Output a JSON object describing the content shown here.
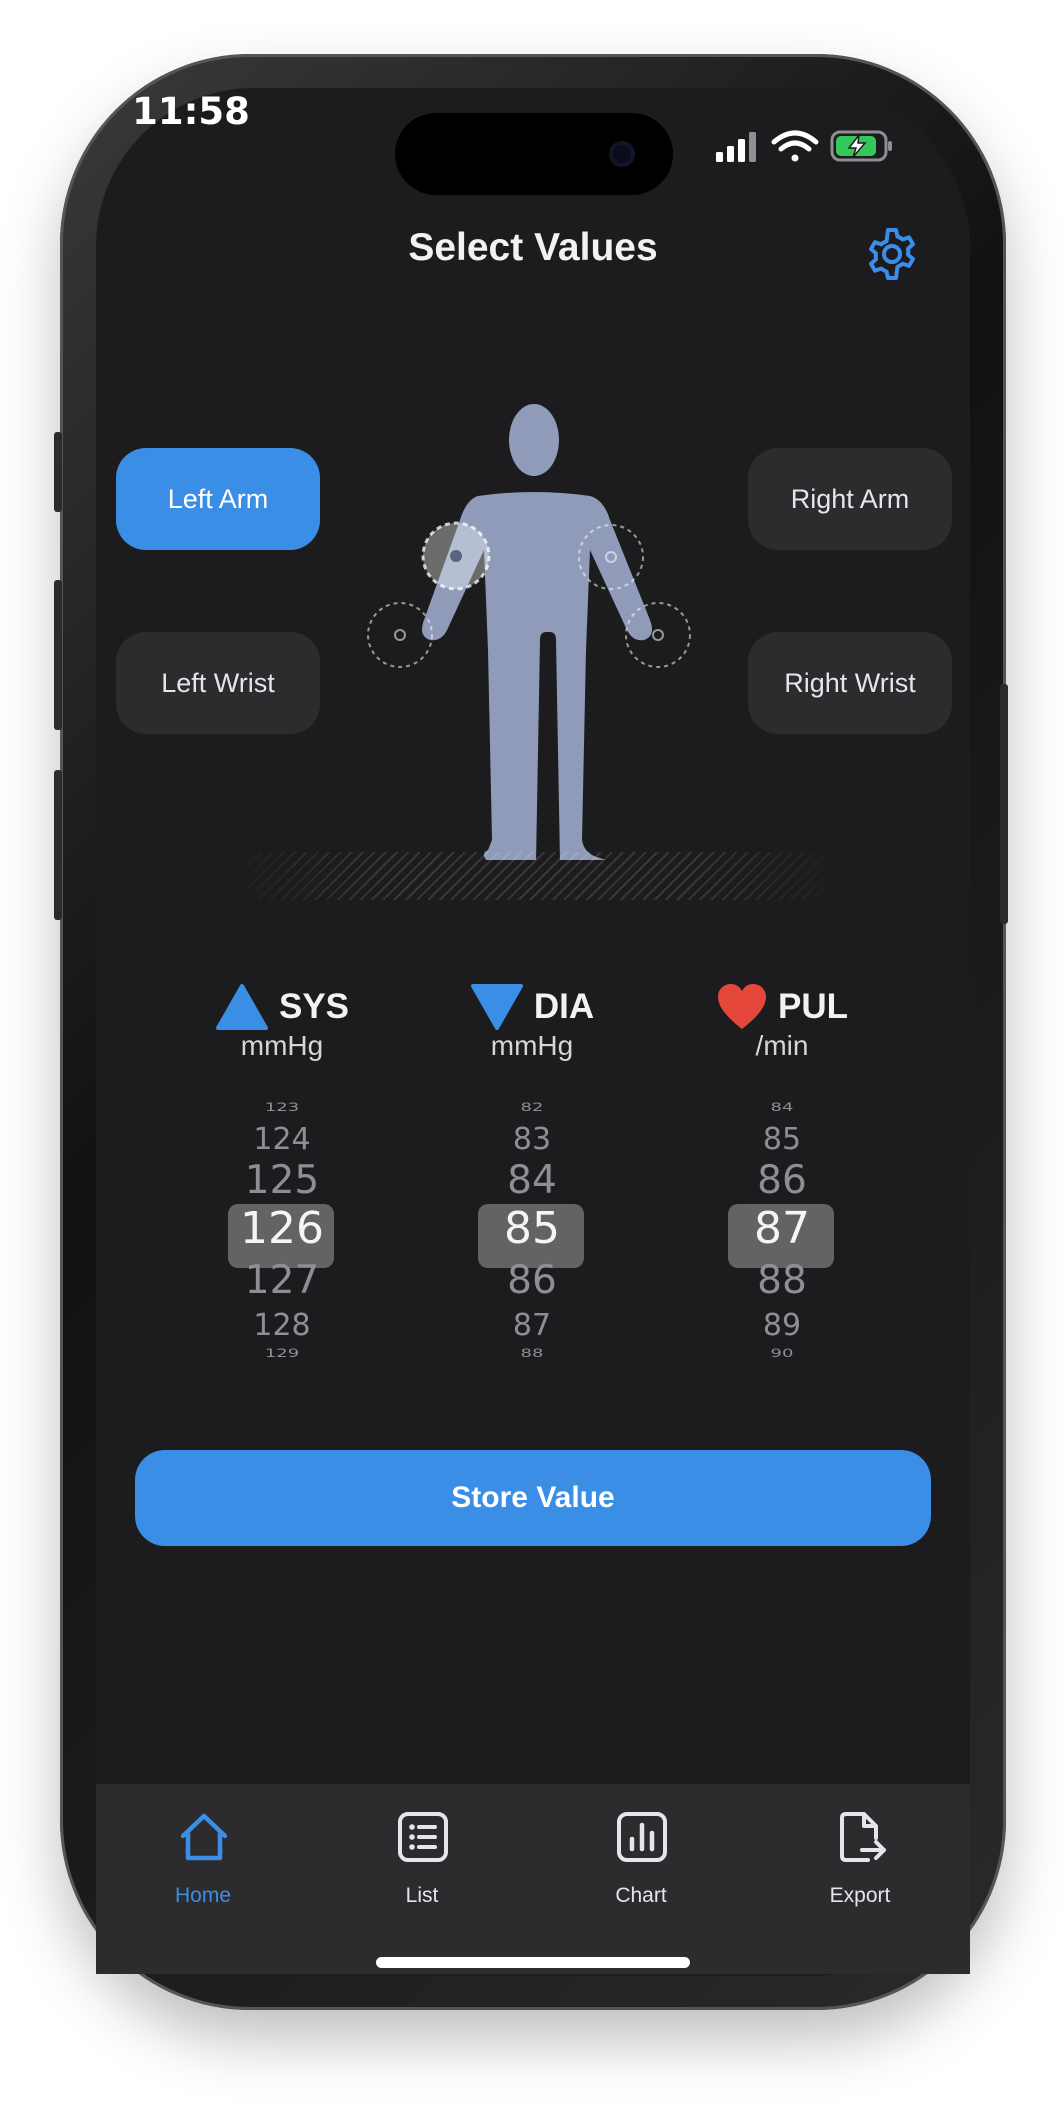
{
  "status": {
    "time": "11:58"
  },
  "header": {
    "title": "Select Values",
    "settings_icon": "gear-icon"
  },
  "positions": {
    "left_arm": "Left Arm",
    "right_arm": "Right Arm",
    "left_wrist": "Left Wrist",
    "right_wrist": "Right Wrist",
    "selected": "Left Arm"
  },
  "readings": {
    "sys": {
      "label": "SYS",
      "unit": "mmHg",
      "icon": "triangle-up-icon",
      "values": [
        "123",
        "124",
        "125",
        "126",
        "127",
        "128",
        "129"
      ],
      "selected": "126"
    },
    "dia": {
      "label": "DIA",
      "unit": "mmHg",
      "icon": "triangle-down-icon",
      "values": [
        "82",
        "83",
        "84",
        "85",
        "86",
        "87",
        "88"
      ],
      "selected": "85"
    },
    "pul": {
      "label": "PUL",
      "unit": "/min",
      "icon": "heart-icon",
      "values": [
        "84",
        "85",
        "86",
        "87",
        "88",
        "89",
        "90"
      ],
      "selected": "87"
    }
  },
  "actions": {
    "store": "Store Value"
  },
  "tabs": [
    {
      "label": "Home",
      "icon": "house-icon",
      "active": true
    },
    {
      "label": "List",
      "icon": "list-icon",
      "active": false
    },
    {
      "label": "Chart",
      "icon": "chart-icon",
      "active": false
    },
    {
      "label": "Export",
      "icon": "export-icon",
      "active": false
    }
  ],
  "colors": {
    "accent": "#3a8ee6",
    "background": "#1c1c1e",
    "heart": "#e5483b"
  }
}
